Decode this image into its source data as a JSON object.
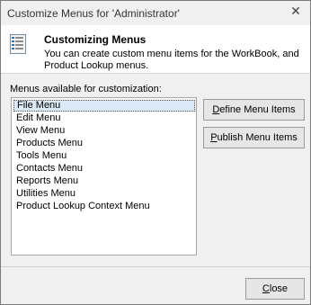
{
  "window": {
    "title": "Customize Menus for 'Administrator'",
    "close_glyph": "✕"
  },
  "header": {
    "icon": "menu-list-icon",
    "title": "Customizing Menus",
    "description": "You can create custom menu items for the WorkBook, and Product Lookup menus."
  },
  "menus": {
    "label": "Menus available for customization:",
    "selected_index": 0,
    "items": [
      "File Menu",
      "Edit Menu",
      "View Menu",
      "Products Menu",
      "Tools Menu",
      "Contacts Menu",
      "Reports Menu",
      "Utilities Menu",
      "Product Lookup Context Menu"
    ]
  },
  "buttons": {
    "define": {
      "first": "D",
      "rest": "efine Menu Items"
    },
    "publish": {
      "first": "P",
      "rest": "ublish Menu Items"
    },
    "close": {
      "first": "C",
      "rest": "lose"
    }
  }
}
